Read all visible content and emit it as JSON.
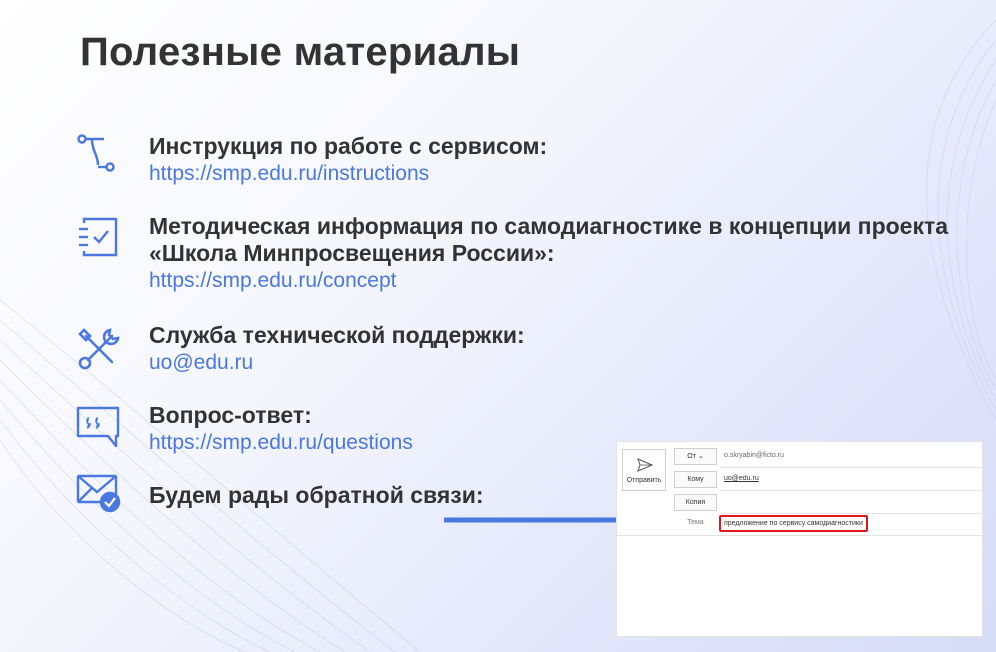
{
  "title": "Полезные материалы",
  "items": [
    {
      "heading": "Инструкция по работе с сервисом:",
      "link": "https://smp.edu.ru/instructions",
      "icon": "route-icon"
    },
    {
      "heading": "Методическая информация по самодиагностике в концепции проекта «Школа Минпросвещения России»:",
      "link": "https://smp.edu.ru/concept",
      "icon": "checklist-icon"
    },
    {
      "heading": "Служба технической поддержки:",
      "link": "uo@edu.ru",
      "icon": "tools-icon"
    },
    {
      "heading": "Вопрос-ответ:",
      "link": "https://smp.edu.ru/questions",
      "icon": "quote-bubble-icon"
    },
    {
      "heading": "Будем рады обратной связи:",
      "icon": "mail-check-icon"
    }
  ],
  "email": {
    "send_label": "Отправить",
    "from_label": "От",
    "from_value": "o.skryabin@ficto.ru",
    "to_label": "Кому",
    "to_value": "uo@edu.ru",
    "cc_label": "Копия",
    "subject_label": "Тема",
    "subject_value": "предложение по сервису самодиагностики"
  },
  "colors": {
    "accent": "#4a78e0",
    "title": "#333333",
    "highlight_border": "#e01818"
  }
}
